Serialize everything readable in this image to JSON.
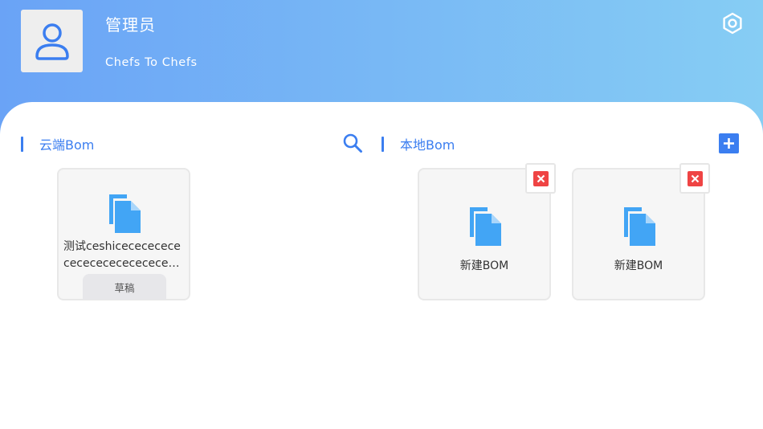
{
  "user": {
    "name": "管理员",
    "company": "Chefs To Chefs"
  },
  "icons": {
    "avatar": "user-icon",
    "settings": "gear-icon",
    "search": "search-icon",
    "add": "plus-icon",
    "document": "document-copy-icon",
    "delete": "close-icon"
  },
  "colors": {
    "accent": "#3b7ef0",
    "delete": "#ef4444",
    "header_start": "#6aa3f6",
    "header_end": "#86cdf4"
  },
  "cloud": {
    "title": "云端Bom",
    "items": [
      {
        "name": "测试ceshicecececececececececececececec",
        "status": "草稿"
      }
    ]
  },
  "local": {
    "title": "本地Bom",
    "items": [
      {
        "name": "新建BOM"
      },
      {
        "name": "新建BOM"
      }
    ]
  }
}
